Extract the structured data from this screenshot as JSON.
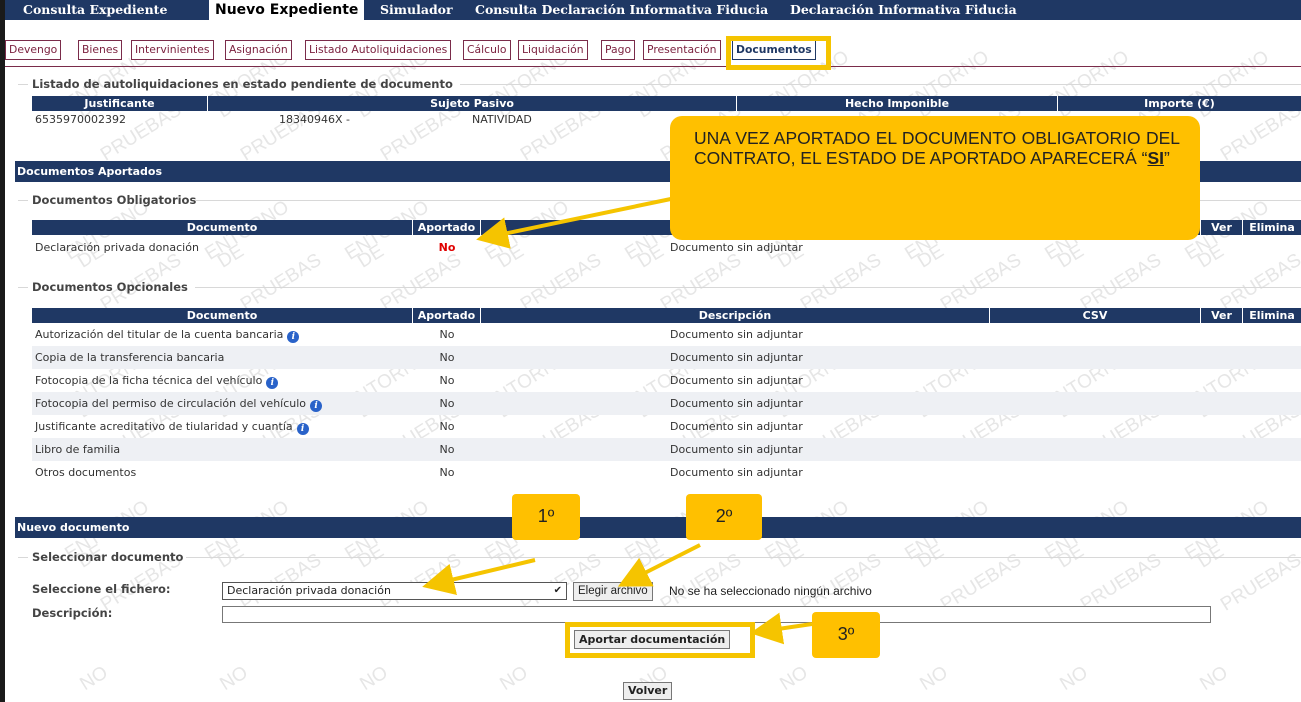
{
  "top_menu": [
    {
      "label": "Consulta Expediente",
      "active": false
    },
    {
      "label": "Nuevo Expediente",
      "active": true
    },
    {
      "label": "Simulador",
      "active": false
    },
    {
      "label": "Consulta Declaración Informativa Fiducia",
      "active": false
    },
    {
      "label": "Declaración Informativa Fiducia",
      "active": false
    }
  ],
  "tabs": [
    {
      "label": "Devengo"
    },
    {
      "label": "Bienes"
    },
    {
      "label": "Intervinientes"
    },
    {
      "label": "Asignación"
    },
    {
      "label": "Listado Autoliquidaciones"
    },
    {
      "label": "Cálculo"
    },
    {
      "label": "Liquidación"
    },
    {
      "label": "Pago"
    },
    {
      "label": "Presentación"
    },
    {
      "label": "Documentos",
      "active": true
    }
  ],
  "pending": {
    "title": "Listado de autoliquidaciones en estado pendiente de documento",
    "columns": [
      "Justificante",
      "Sujeto Pasivo",
      "Hecho Imponible",
      "Importe (€)"
    ],
    "row": {
      "justificante": "6535970002392",
      "nif": "18340946X -",
      "nombre": "NATIVIDAD"
    }
  },
  "aportados": {
    "header": "Documentos Aportados",
    "obligatorios": {
      "title": "Documentos Obligatorios",
      "columns": {
        "documento": "Documento",
        "aportado": "Aportado",
        "ver": "Ver",
        "eliminar": "Elimina"
      },
      "rows": [
        {
          "documento": "Declaración privada donación",
          "aportado": "No",
          "descripcion": "Documento sin adjuntar"
        }
      ]
    },
    "opcionales": {
      "title": "Documentos Opcionales",
      "columns": {
        "documento": "Documento",
        "aportado": "Aportado",
        "descripcion": "Descripción",
        "csv": "CSV",
        "ver": "Ver",
        "eliminar": "Elimina"
      },
      "rows": [
        {
          "documento": "Autorización del titular de la cuenta bancaria",
          "info": true,
          "aportado": "No",
          "descripcion": "Documento sin adjuntar"
        },
        {
          "documento": "Copia de la transferencia bancaria",
          "info": false,
          "aportado": "No",
          "descripcion": "Documento sin adjuntar"
        },
        {
          "documento": "Fotocopia de la ficha técnica del vehículo",
          "info": true,
          "aportado": "No",
          "descripcion": "Documento sin adjuntar"
        },
        {
          "documento": "Fotocopia del permiso de circulación del vehículo",
          "info": true,
          "aportado": "No",
          "descripcion": "Documento sin adjuntar"
        },
        {
          "documento": "Justificante acreditativo de tiularidad y cuantía",
          "info": true,
          "aportado": "No",
          "descripcion": "Documento sin adjuntar"
        },
        {
          "documento": "Libro de familia",
          "info": false,
          "aportado": "No",
          "descripcion": "Documento sin adjuntar"
        },
        {
          "documento": "Otros documentos",
          "info": false,
          "aportado": "No",
          "descripcion": "Documento sin adjuntar"
        }
      ]
    }
  },
  "nuevo": {
    "header": "Nuevo documento",
    "group_title": "Seleccionar documento",
    "fichero_label": "Seleccione el fichero:",
    "selected_option": "Declaración privada donación",
    "file_button": "Elegir archivo",
    "file_status": "No se ha seleccionado ningún archivo",
    "descripcion_label": "Descripción:",
    "descripcion_value": "",
    "submit": "Aportar documentación"
  },
  "volver": "Volver",
  "annotations": {
    "main_prefix": "UNA VEZ APORTADO EL DOCUMENTO OBLIGATORIO DEL CONTRATO, EL ESTADO DE APORTADO APARECERÁ “",
    "main_emph": "SI",
    "main_suffix": "”",
    "step1": "1º",
    "step2": "2º",
    "step3": "3º"
  },
  "watermark": {
    "w1": "ENTORNO",
    "w2": "DE",
    "w3": "PRUEBAS",
    "w4": "NO"
  },
  "colors": {
    "header_navy": "#1f3864",
    "highlight": "#f5c400",
    "callout": "#ffc000",
    "alert_red": "#e00000",
    "tab_border": "#7a2b4a"
  }
}
